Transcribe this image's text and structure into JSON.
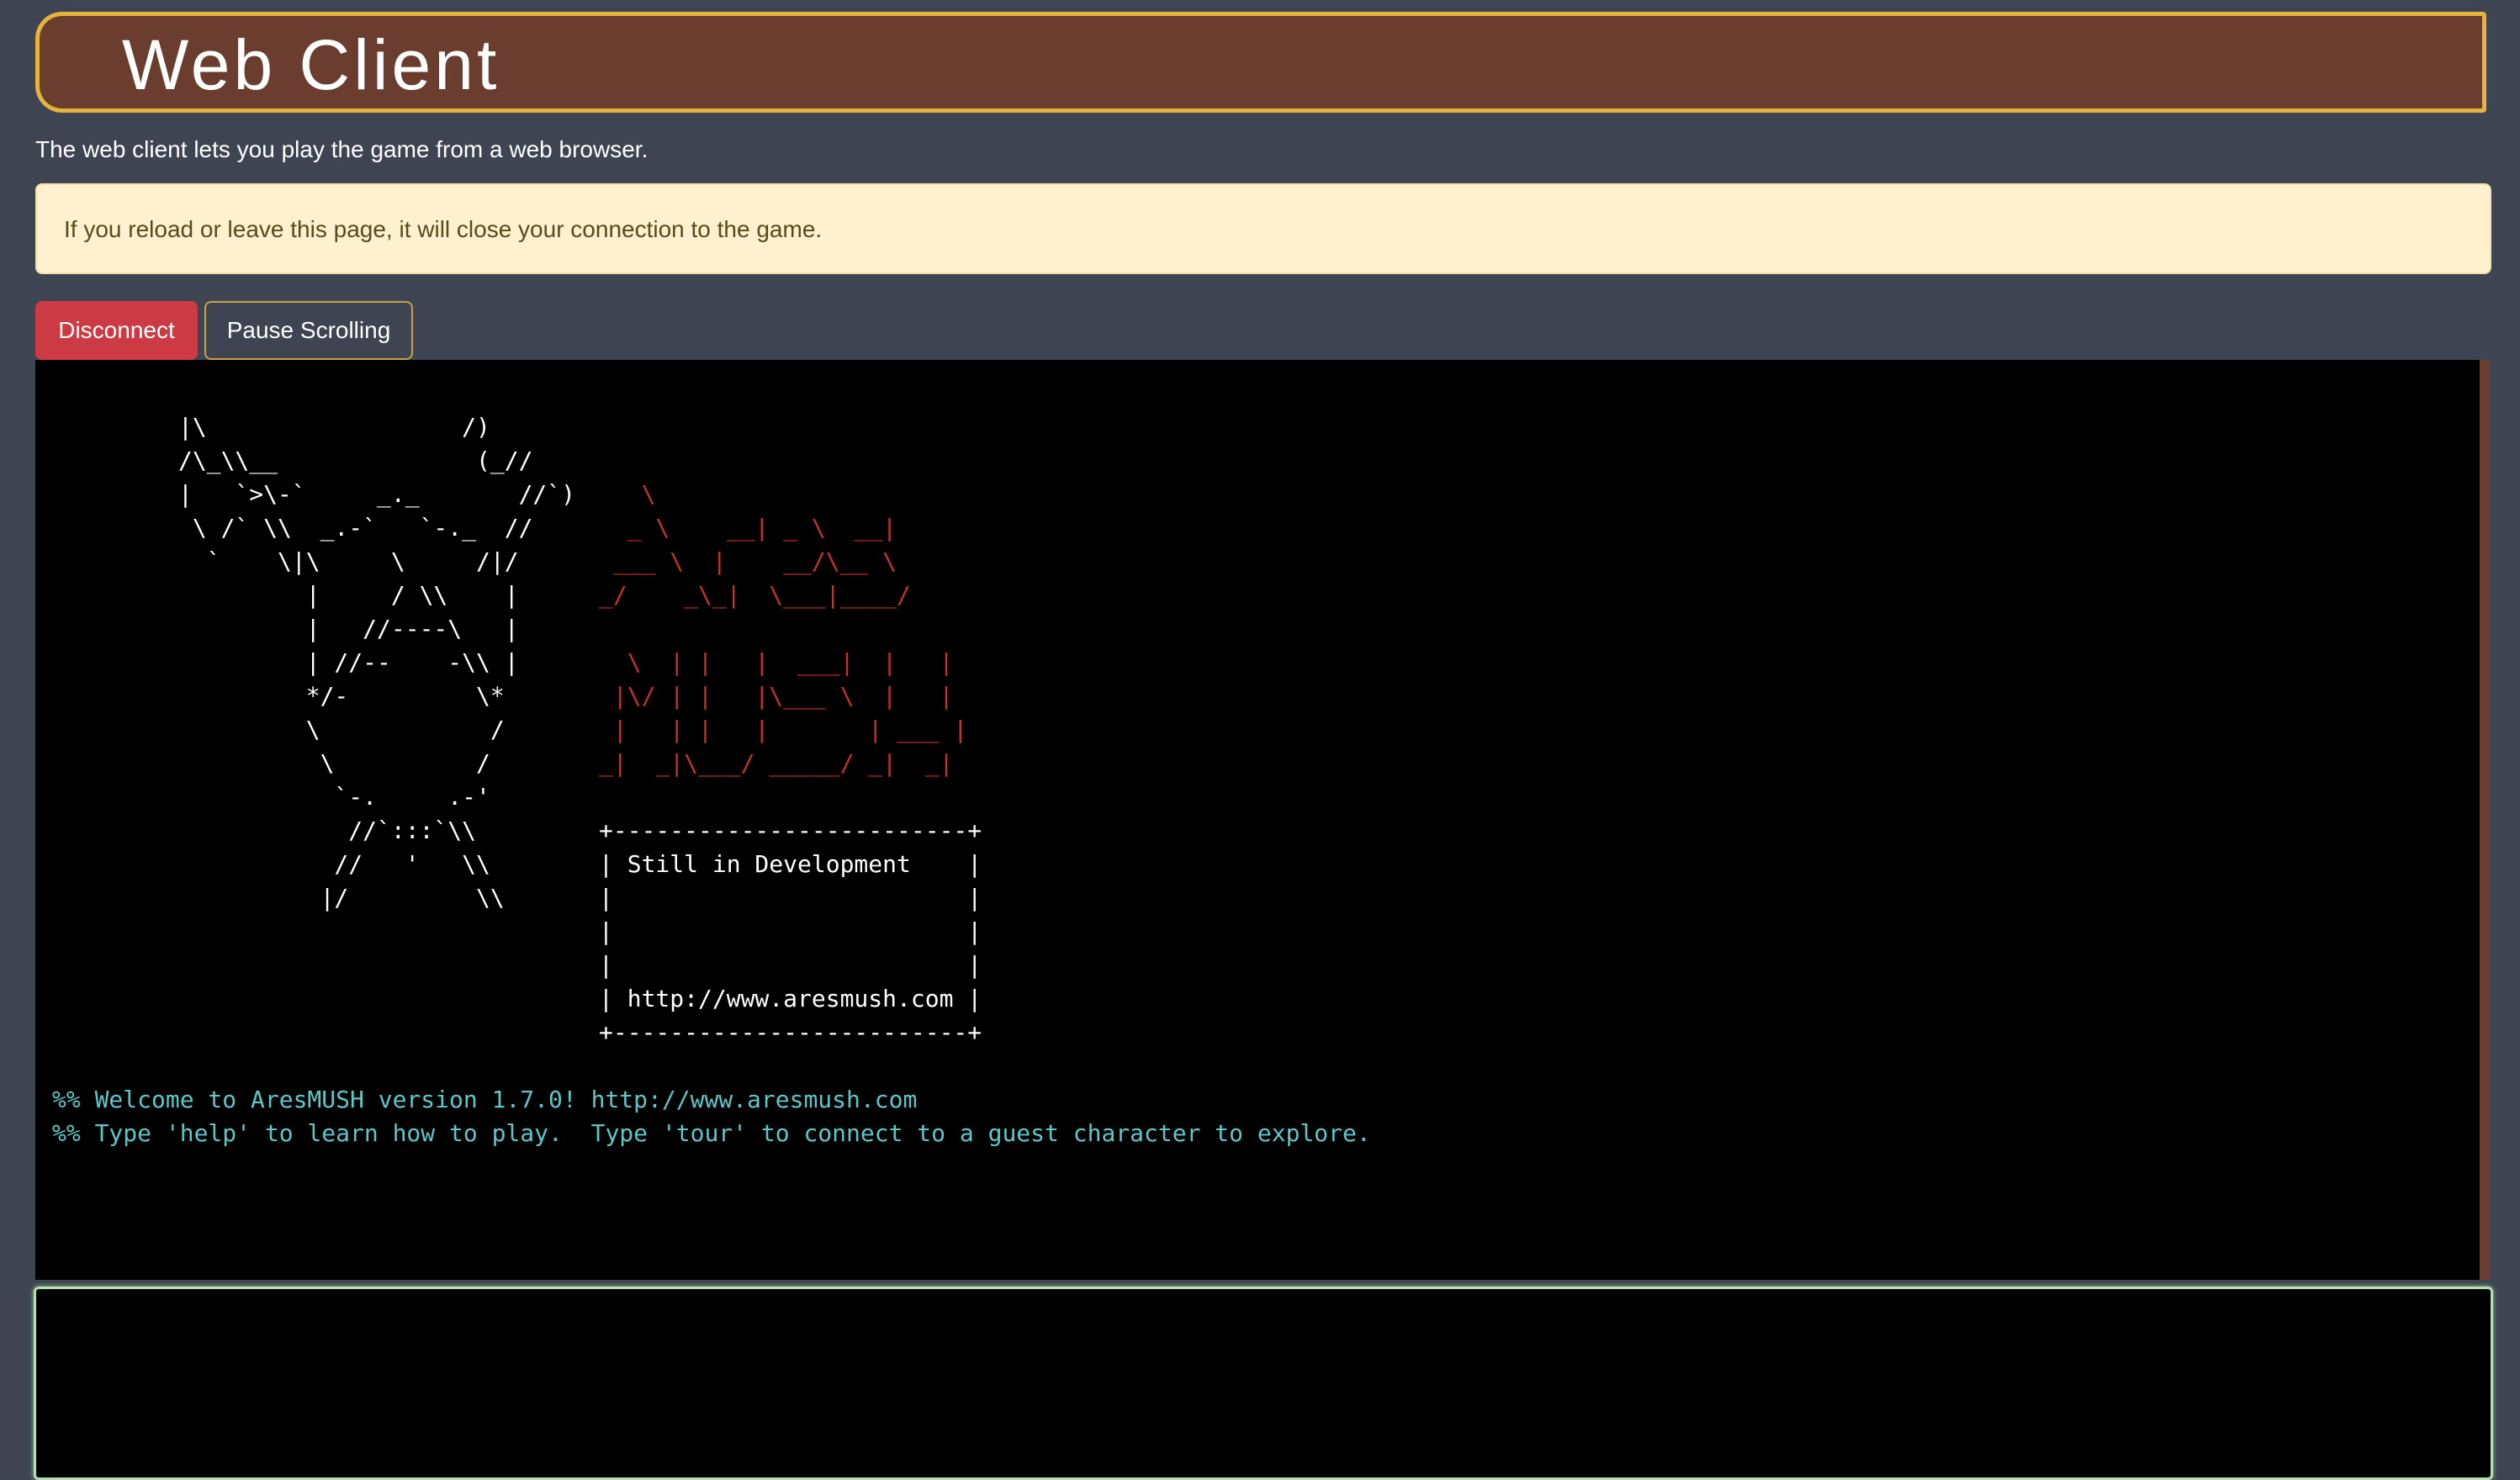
{
  "header": {
    "title": "Web Client"
  },
  "intro": {
    "text": "The web client lets you play the game from a web browser."
  },
  "alert": {
    "text": "If you reload or leave this page, it will close your connection to the game."
  },
  "toolbar": {
    "disconnect_label": "Disconnect",
    "pause_label": "Pause Scrolling"
  },
  "terminal": {
    "ascii_figure": "|\\                  /)\n/\\_\\\\__              (_//\n|   `>\\-`     _._       //`)\n \\ /` \\\\  _.-`   `-._  //\n  `    \\|\\     \\     /|/\n         |     / \\\\    |\n         |   //----\\   |\n         | //--    -\\\\ |\n         */-         \\*\n         \\            /\n          \\          /\n           `-.     .-'\n            //`:::`\\\\\n           //   '   \\\\\n          |/         \\\\",
    "ascii_logo": "   \\\n  _ \\    __| _ \\  __|\n ___ \\  |    __/\\__ \\\n_/    _\\_|  \\___|____/\n\n  \\  | |   |  ___|  |   |\n |\\/ | |   |\\___ \\  |   |\n |   | |   |       | ___ |\n_|  _|\\___/ _____/ _|  _|",
    "ascii_box": "+-------------------------+\n| Still in Development    |\n|                         |\n|                         |\n|                         |\n| http://www.aresmush.com |\n+-------------------------+",
    "welcome_lines": "%% Welcome to AresMUSH version 1.7.0! http://www.aresmush.com\n%% Type 'help' to learn how to play.  Type 'tour' to connect to a guest character to explore."
  },
  "input": {
    "value": "",
    "placeholder": ""
  },
  "colors": {
    "page_background": "#3e4452",
    "header_background": "#6b3d2e",
    "header_border": "#e4b43f",
    "alert_background": "#fdf1cf",
    "disconnect_button": "#cc3b43",
    "terminal_background": "#000000",
    "logo_red": "#c7312c",
    "welcome_cyan": "#5fc6c6"
  }
}
